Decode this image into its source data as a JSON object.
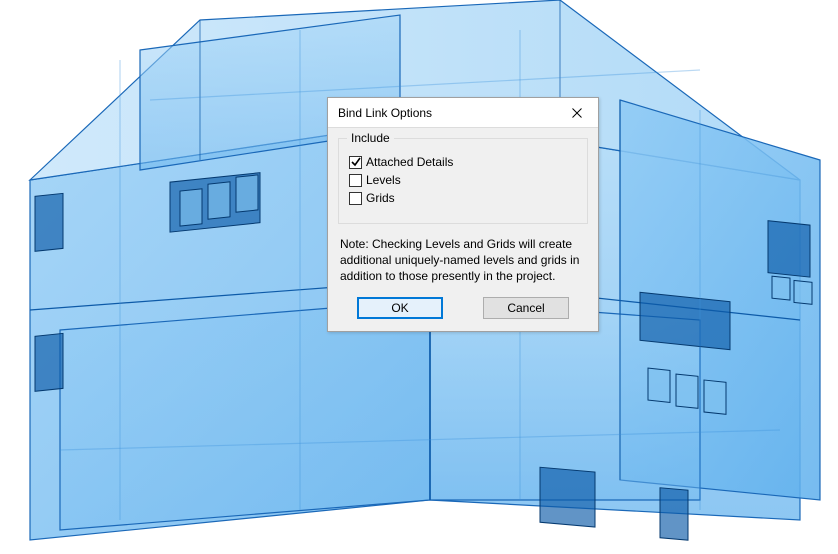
{
  "dialog": {
    "title": "Bind Link Options",
    "include": {
      "legend": "Include",
      "options": [
        {
          "label": "Attached Details",
          "checked": true
        },
        {
          "label": "Levels",
          "checked": false
        },
        {
          "label": "Grids",
          "checked": false
        }
      ]
    },
    "note": "Note: Checking Levels and Grids will create additional uniquely-named levels and grids in addition to those presently in the project.",
    "buttons": {
      "ok": "OK",
      "cancel": "Cancel"
    }
  }
}
